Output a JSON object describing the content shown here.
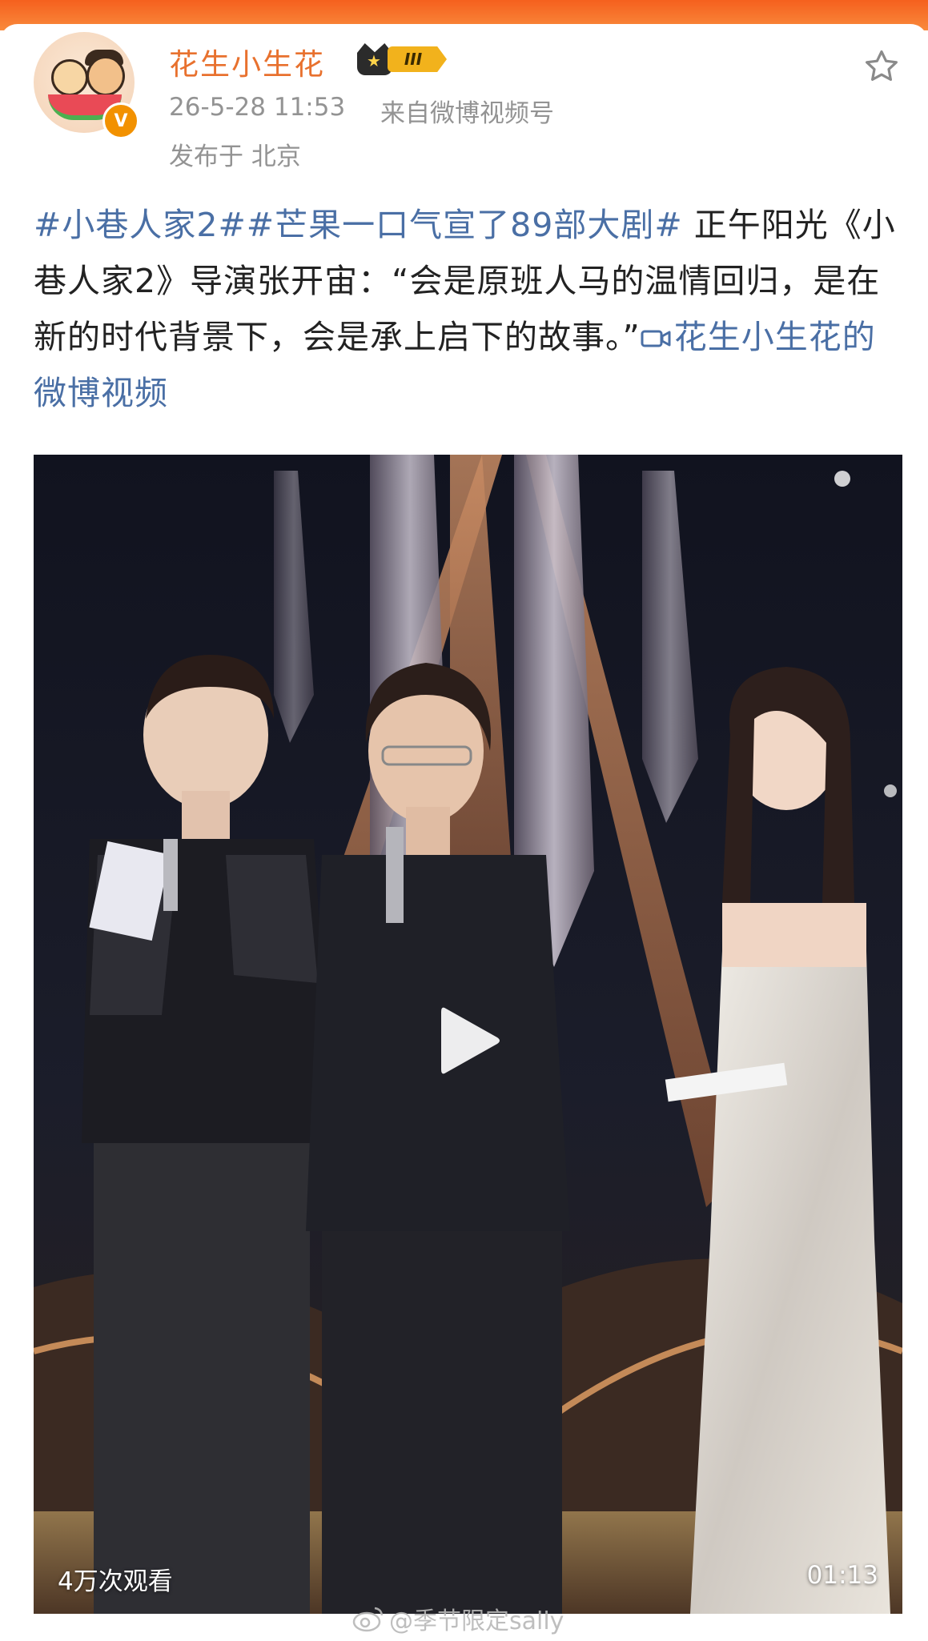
{
  "header": {
    "user_name": "花生小生花",
    "vip_level": "III",
    "verified_mark": "V",
    "post_time": "26-5-28 11:53",
    "post_source": "来自微博视频号",
    "post_location": "发布于 北京",
    "icons": [
      "avatar",
      "verified-icon",
      "vip-crown-icon",
      "star-icon"
    ]
  },
  "post": {
    "tag1": "#小巷人家2#",
    "tag2": "#芒果一口气宣了89部大剧#",
    "body": " 正午阳光《小巷人家2》导演张开宙：“会是原班人马的温情回归，是在新的时代背景下，会是承上启下的故事。”",
    "video_link": "花生小生花的微博视频"
  },
  "video": {
    "view_count": "4万次观看",
    "duration": "01:13",
    "icons": [
      "play-icon",
      "video-camera-icon"
    ]
  },
  "watermark": {
    "text": "@季节限定sally",
    "icon": "weibo-logo-icon"
  },
  "colors": {
    "accent_orange": "#e8712e",
    "link_blue": "#4a6fa5",
    "meta_gray": "#939393"
  }
}
